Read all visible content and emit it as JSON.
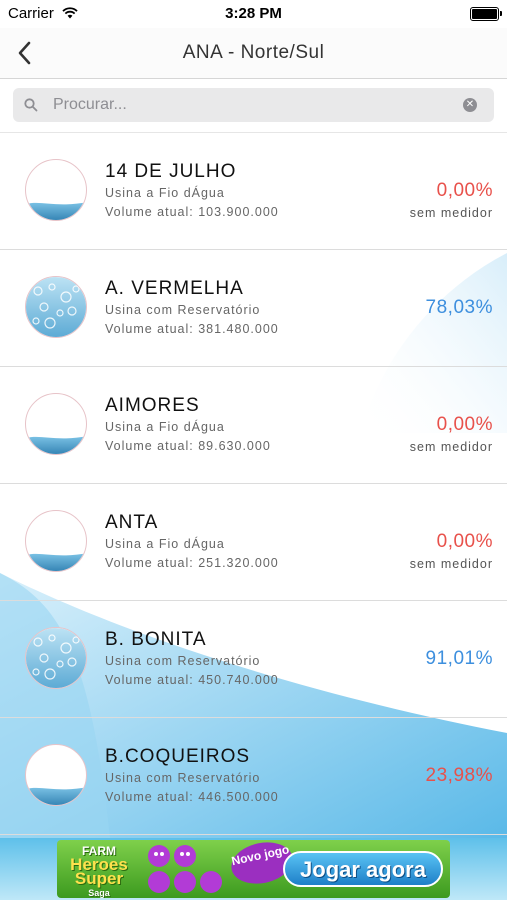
{
  "status_bar": {
    "carrier": "Carrier",
    "time": "3:28 PM"
  },
  "nav": {
    "title": "ANA - Norte/Sul"
  },
  "search": {
    "placeholder": "Procurar..."
  },
  "rows": [
    {
      "name": "14 DE JULHO",
      "type": "Usina a Fio dÁgua",
      "volume": "Volume atual: 103.900.000",
      "percent": "0,00%",
      "percent_color": "red",
      "meter": "sem medidor",
      "avatar": "water-low"
    },
    {
      "name": "A. VERMELHA",
      "type": "Usina com Reservatório",
      "volume": "Volume atual: 381.480.000",
      "percent": "78,03%",
      "percent_color": "blue",
      "meter": "",
      "avatar": "water-high"
    },
    {
      "name": "AIMORES",
      "type": "Usina a Fio dÁgua",
      "volume": "Volume atual: 89.630.000",
      "percent": "0,00%",
      "percent_color": "red",
      "meter": "sem medidor",
      "avatar": "water-low"
    },
    {
      "name": "ANTA",
      "type": "Usina a Fio dÁgua",
      "volume": "Volume atual: 251.320.000",
      "percent": "0,00%",
      "percent_color": "red",
      "meter": "sem medidor",
      "avatar": "water-low"
    },
    {
      "name": "B. BONITA",
      "type": "Usina com Reservatório",
      "volume": "Volume atual: 450.740.000",
      "percent": "91,01%",
      "percent_color": "blue",
      "meter": "",
      "avatar": "water-high"
    },
    {
      "name": "B.COQUEIROS",
      "type": "Usina com Reservatório",
      "volume": "Volume atual: 446.500.000",
      "percent": "23,98%",
      "percent_color": "red",
      "meter": "",
      "avatar": "water-low"
    }
  ],
  "ad": {
    "logo_top": "FARM",
    "logo_mid": "Heroes",
    "logo_bottom": "Super",
    "logo_small": "Saga",
    "badge": "Novo jogo",
    "cta": "Jogar agora"
  },
  "colors": {
    "red": "#e8514b",
    "blue": "#3d8fde"
  }
}
